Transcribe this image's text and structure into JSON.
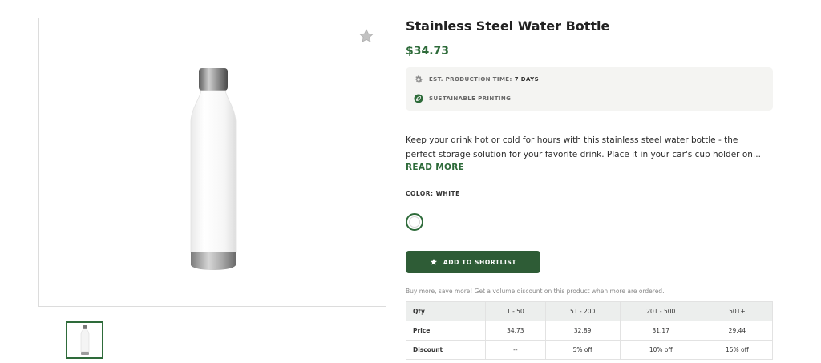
{
  "product": {
    "title": "Stainless Steel Water Bottle",
    "price": "$34.73",
    "badges": {
      "production_label": "EST. PRODUCTION TIME:",
      "production_value": "7 DAYS",
      "sustainable_label": "SUSTAINABLE PRINTING"
    },
    "description_lines": [
      "Keep your drink hot or cold for hours with this stainless steel water bottle - the",
      "perfect storage solution for your favorite drink. Place it in your car's cup holder on..."
    ],
    "read_more": "READ MORE",
    "color_label": "COLOR: WHITE",
    "selected_color": "#ffffff",
    "shortlist_label": "ADD TO SHORTLIST"
  },
  "volume": {
    "note": "Buy more, save more! Get a volume discount on this product when more are ordered.",
    "headers": [
      "Qty",
      "1 - 50",
      "51 - 200",
      "201 - 500",
      "501+"
    ],
    "rows": [
      [
        "Price",
        "34.73",
        "32.89",
        "31.17",
        "29.44"
      ],
      [
        "Discount",
        "--",
        "5% off",
        "10% off",
        "15% off"
      ]
    ]
  },
  "icons": {
    "favorite": "star-icon",
    "production": "gear-icon",
    "sustainable": "leaf-icon",
    "shortlist": "star-icon"
  },
  "colors": {
    "accent": "#2e6b3a",
    "button": "#2e5c36",
    "badge_bg": "#f4f4f2"
  }
}
